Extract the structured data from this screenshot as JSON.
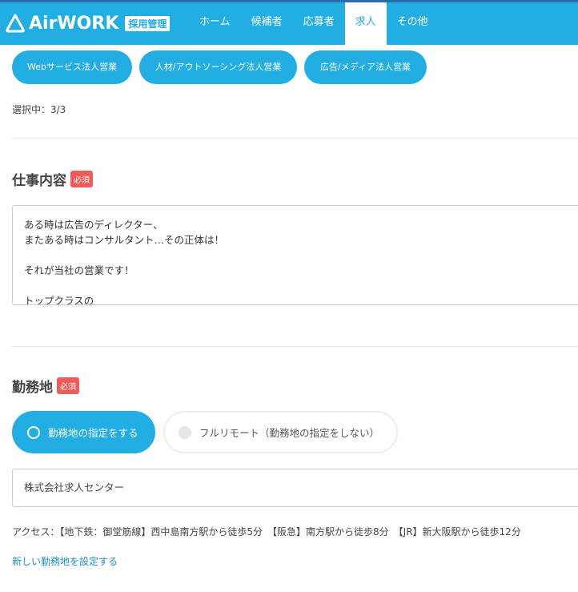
{
  "header": {
    "brand": "AirWORK",
    "tag": "採用管理",
    "nav": [
      "ホーム",
      "候補者",
      "応募者",
      "求人",
      "その他"
    ],
    "active": "求人",
    "accent": "#22ade3"
  },
  "job_types": [
    "Webサービス法人営業",
    "人材/アウトソーシング法人営業",
    "広告/メディア法人営業"
  ],
  "selected_count": "選択中：3/3",
  "job_description": {
    "title": "仕事内容",
    "required": "必須",
    "value": "ある時は広告のディレクター、\nまたある時はコンサルタント…その正体は！\n\nそれが当社の営業です！\n\nトップクラスの\n"
  },
  "location": {
    "title": "勤務地",
    "required": "必須",
    "options": [
      "勤務地の指定をする",
      "フルリモート（勤務地の指定をしない）"
    ],
    "selected": "勤務地の指定をする",
    "value": "株式会社求人センター",
    "access": "アクセス：【地下鉄：御堂筋線】西中島南方駅から徒歩5分　【阪急】南方駅から徒歩8分　【JR】新大阪駅から徒歩12分",
    "new_link": "新しい勤務地を設定する"
  }
}
